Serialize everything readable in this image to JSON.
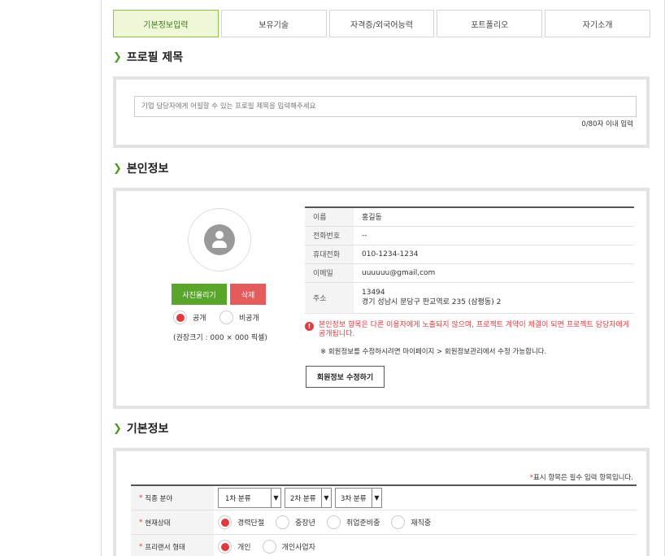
{
  "tabs": [
    {
      "label": "기본정보입력",
      "active": true
    },
    {
      "label": "보유기술",
      "active": false
    },
    {
      "label": "자격증/외국어능력",
      "active": false
    },
    {
      "label": "포트폴리오",
      "active": false
    },
    {
      "label": "자기소개",
      "active": false
    }
  ],
  "profile_title": {
    "heading": "프로필 제목",
    "placeholder": "기업 담당자에게 어필할 수 있는 프로필 제목을 입력해주세요",
    "char_count": "0/80자 이내 입력"
  },
  "personal": {
    "heading": "본인정보",
    "upload_label": "사진올리기",
    "delete_label": "삭제",
    "public_label": "공개",
    "private_label": "비공개",
    "visibility": "공개",
    "size_note": "(권장크기 : 000 × 000 픽셀)",
    "rows": [
      {
        "label": "이름",
        "value": "홍길동"
      },
      {
        "label": "전화번호",
        "value": "--"
      },
      {
        "label": "휴대전화",
        "value": "010-1234-1234"
      },
      {
        "label": "이메일",
        "value": "uuuuuu@gmail,com"
      },
      {
        "label": "주소",
        "value": "13494",
        "value2": "경기 성남시 분당구 판교역로 235 (삼평동) 2"
      }
    ],
    "warning": "본인정보 항목은 다른 이용자에게 노출되지 않으며, 프로젝트 계약이 체결이 되면 프로젝트 담당자에게 공개됩니다.",
    "note": "※ 회원정보를 수정하시려면 마이페이지 > 회원정보관리에서 수정 가능합니다.",
    "edit_button": "회원정보 수정하기"
  },
  "basic": {
    "heading": "기본정보",
    "required_star": "*",
    "required_note": "표시 항목은 필수 입력 항목입니다.",
    "job_field_label": "직종 분야",
    "job_selects": [
      "1차 분류",
      "2차 분류",
      "3차 분류"
    ],
    "status_label": "현재상태",
    "status_options": [
      "경력단절",
      "중장년",
      "취업준비중",
      "재직중"
    ],
    "status_selected": "경력단절",
    "freelancer_label": "프리랜서 형태",
    "freelancer_options": [
      "개인",
      "개인사업자"
    ],
    "freelancer_selected": "개인"
  },
  "colors": {
    "accent_green": "#5aa52c",
    "danger_red": "#e0393e",
    "tab_active_bg": "#eef8d8"
  }
}
